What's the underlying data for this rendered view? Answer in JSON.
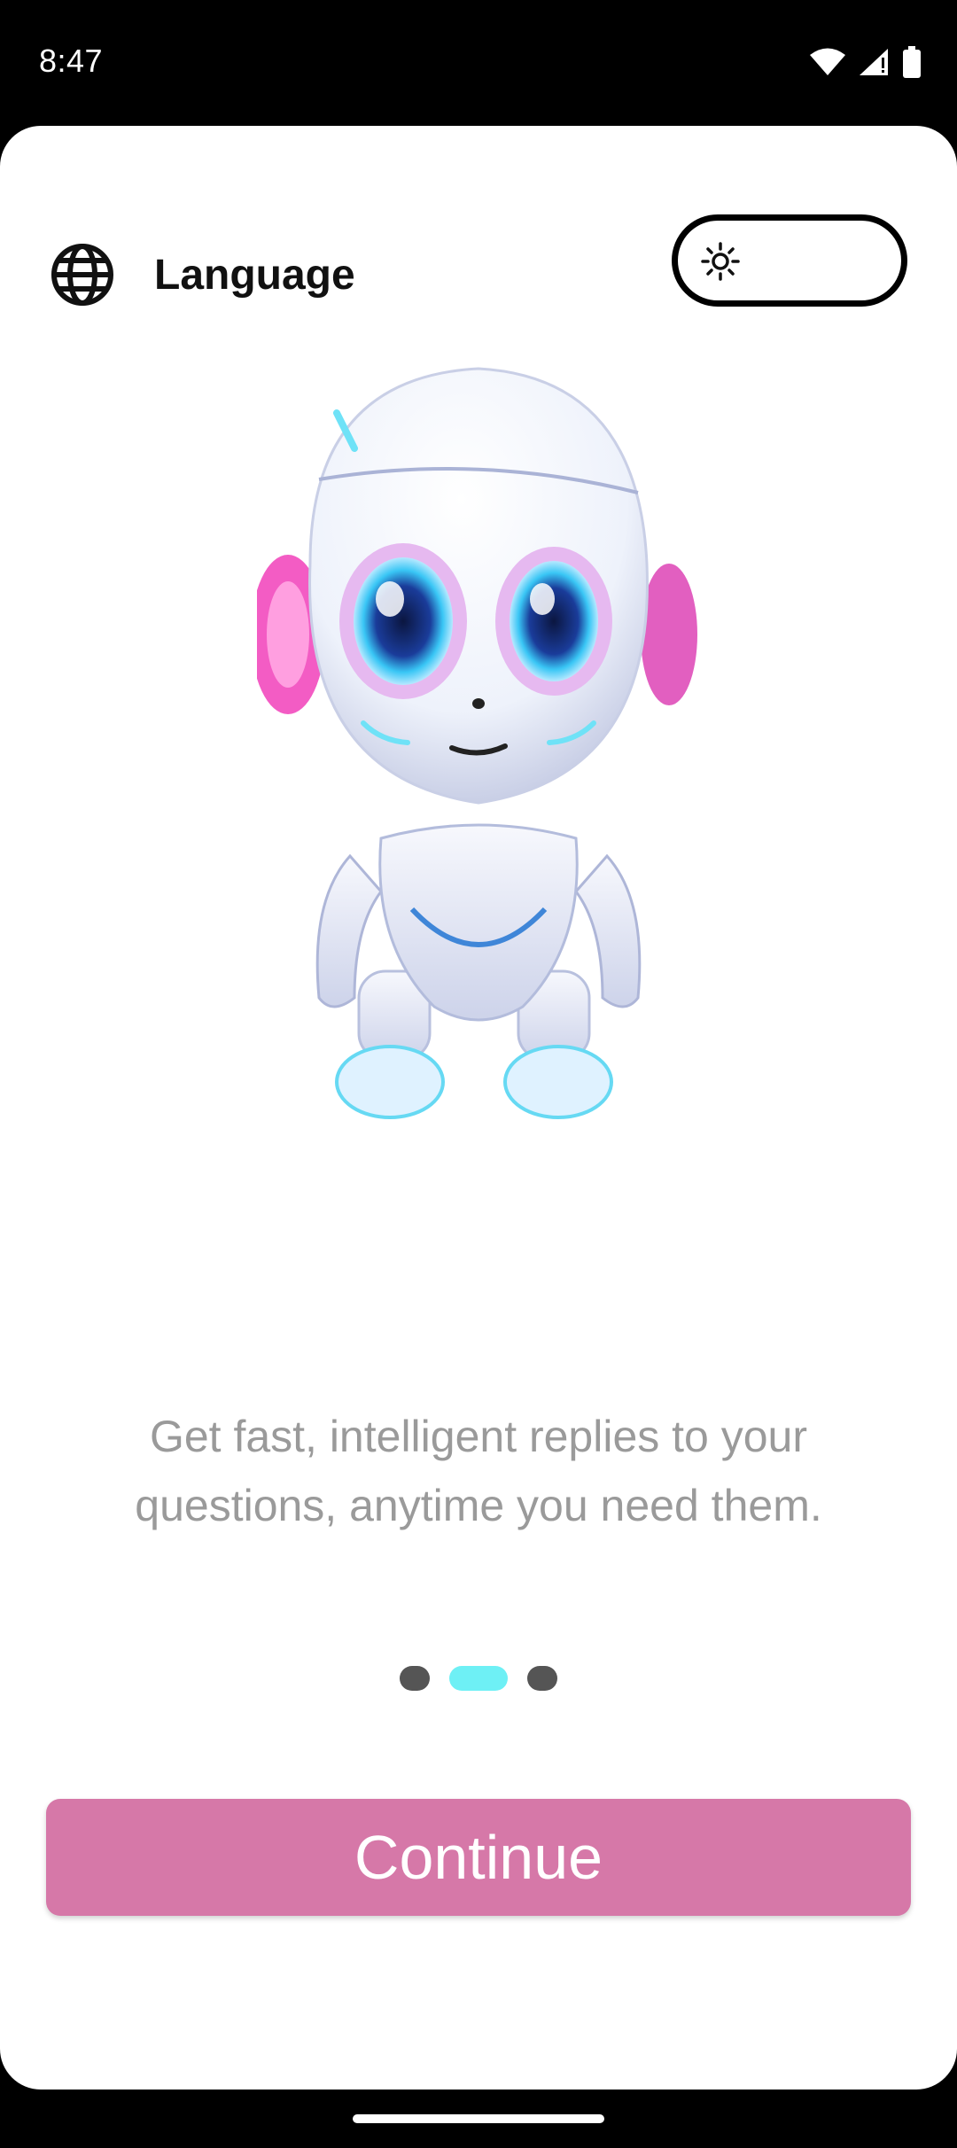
{
  "status_bar": {
    "time": "8:47",
    "icons": [
      "wifi-icon",
      "cell-signal-icon",
      "battery-icon"
    ]
  },
  "header": {
    "language_label": "Language",
    "language_icon": "globe-icon",
    "theme_icon": "sun-icon"
  },
  "illustration": "robot-illustration",
  "onboarding": {
    "description_line1": "Get fast, intelligent replies to your",
    "description_line2": "questions, anytime you need them.",
    "page_count": 3,
    "active_page": 2
  },
  "continue_label": "Continue",
  "colors": {
    "primary_button": "#d678a8",
    "active_dot": "#6ef0f5",
    "inactive_dot": "#555555",
    "description_text": "#9a9a9a"
  }
}
